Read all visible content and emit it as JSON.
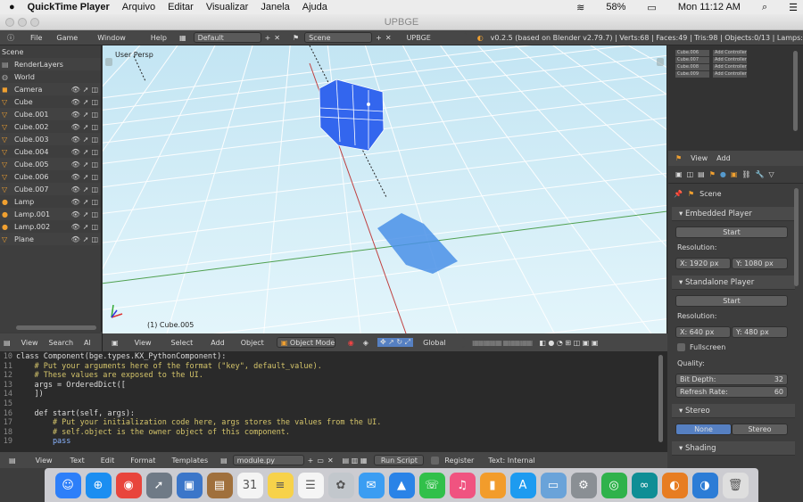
{
  "mac_menu": {
    "apple": "",
    "app": "QuickTime Player",
    "items": [
      "Arquivo",
      "Editar",
      "Visualizar",
      "Janela",
      "Ajuda"
    ],
    "battery": "58%",
    "clock": "Mon 11:12 AM"
  },
  "window": {
    "title": "UPBGE"
  },
  "info_header": {
    "menus": [
      "File",
      "Game",
      "Window",
      "Help"
    ],
    "layout_field": "Default",
    "scene_field": "Scene",
    "engine_field": "UPBGE",
    "stats": "v0.2.5 (based on Blender v2.79.7) | Verts:68 | Faces:49 | Tris:98 | Objects:0/13 | Lamps:"
  },
  "outliner": {
    "root": "Scene",
    "rows": [
      {
        "label": "RenderLayers",
        "icon": "renderlayers-icon"
      },
      {
        "label": "World",
        "icon": "world-icon"
      },
      {
        "label": "Camera",
        "icon": "camera-icon"
      },
      {
        "label": "Cube",
        "icon": "mesh-icon"
      },
      {
        "label": "Cube.001",
        "icon": "mesh-icon"
      },
      {
        "label": "Cube.002",
        "icon": "mesh-icon"
      },
      {
        "label": "Cube.003",
        "icon": "mesh-icon"
      },
      {
        "label": "Cube.004",
        "icon": "mesh-icon"
      },
      {
        "label": "Cube.005",
        "icon": "mesh-icon"
      },
      {
        "label": "Cube.006",
        "icon": "mesh-icon"
      },
      {
        "label": "Cube.007",
        "icon": "mesh-icon"
      },
      {
        "label": "Lamp",
        "icon": "lamp-icon"
      },
      {
        "label": "Lamp.001",
        "icon": "lamp-icon"
      },
      {
        "label": "Lamp.002",
        "icon": "lamp-icon"
      },
      {
        "label": "Plane",
        "icon": "mesh-icon"
      }
    ]
  },
  "viewport": {
    "persp_label": "User Persp",
    "object_label": "(1) Cube.005"
  },
  "viewport_header": {
    "menus": [
      "View",
      "Select",
      "Add",
      "Object"
    ],
    "mode": "Object Mode",
    "pivot": "Global"
  },
  "outliner_footer": {
    "menus": [
      "View",
      "Search",
      "Al"
    ]
  },
  "text_editor": {
    "lines": [
      {
        "n": "10",
        "code": "class Component(bge.types.KX_PythonComponent):",
        "kind": "normal"
      },
      {
        "n": "11",
        "code": "    # Put your arguments here of the format (\"key\", default_value).",
        "kind": "comment"
      },
      {
        "n": "12",
        "code": "    # These values are exposed to the UI.",
        "kind": "comment"
      },
      {
        "n": "13",
        "code": "    args = OrderedDict([",
        "kind": "normal"
      },
      {
        "n": "14",
        "code": "    ])",
        "kind": "normal"
      },
      {
        "n": "15",
        "code": "",
        "kind": "normal"
      },
      {
        "n": "16",
        "code": "    def start(self, args):",
        "kind": "normal"
      },
      {
        "n": "17",
        "code": "        # Put your initialization code here, args stores the values from the UI.",
        "kind": "comment"
      },
      {
        "n": "18",
        "code": "        # self.object is the owner object of this component.",
        "kind": "comment"
      },
      {
        "n": "19",
        "code": "        pass",
        "kind": "keyword"
      }
    ],
    "footer": {
      "menus": [
        "View",
        "Text",
        "Edit",
        "Format",
        "Templates"
      ],
      "file": "module.py",
      "run_script": "Run Script",
      "register": "Register",
      "text_status": "Text: Internal"
    }
  },
  "logic_panel": {
    "controllers": [
      "Cube.006",
      "Cube.007",
      "Cube.008",
      "Cube.009"
    ],
    "controller_type": "Add Controller"
  },
  "properties": {
    "header_menus": [
      "View",
      "Add"
    ],
    "scene": "Scene",
    "embedded": {
      "title": "Embedded Player",
      "start": "Start",
      "resolution_label": "Resolution:",
      "x": "X:  1920 px",
      "y": "Y:  1080 px"
    },
    "standalone": {
      "title": "Standalone Player",
      "start": "Start",
      "resolution_label": "Resolution:",
      "x": "X:   640 px",
      "y": "Y:   480 px",
      "fullscreen": "Fullscreen",
      "quality_label": "Quality:",
      "bit_depth_label": "Bit Depth:",
      "bit_depth": "32",
      "refresh_label": "Refresh Rate:",
      "refresh": "60"
    },
    "stereo": {
      "title": "Stereo",
      "none": "None",
      "stereo": "Stereo"
    },
    "shading": {
      "title": "Shading"
    }
  },
  "dock": {
    "apps": [
      {
        "name": "finder-icon",
        "color": "#2d7ff9",
        "glyph": "☺"
      },
      {
        "name": "safari-icon",
        "color": "#1b8ef1",
        "glyph": "⊕"
      },
      {
        "name": "chrome-icon",
        "color": "#e8453c",
        "glyph": "◉"
      },
      {
        "name": "launchpad-icon",
        "color": "#6f7a86",
        "glyph": "➚"
      },
      {
        "name": "preview-icon",
        "color": "#3b76c9",
        "glyph": "▣"
      },
      {
        "name": "notebook-icon",
        "color": "#a0703c",
        "glyph": "▤"
      },
      {
        "name": "calendar-icon",
        "color": "#f4f4f4",
        "glyph": "31"
      },
      {
        "name": "notes-icon",
        "color": "#f7d24a",
        "glyph": "≡"
      },
      {
        "name": "reminders-icon",
        "color": "#f5f5f5",
        "glyph": "☰"
      },
      {
        "name": "photos-icon",
        "color": "#c2c7cc",
        "glyph": "✿"
      },
      {
        "name": "messages-icon",
        "color": "#3b9df2",
        "glyph": "✉"
      },
      {
        "name": "keynote-icon",
        "color": "#2a83e7",
        "glyph": "▲"
      },
      {
        "name": "facetime-icon",
        "color": "#31c04a",
        "glyph": "☏"
      },
      {
        "name": "itunes-icon",
        "color": "#f05380",
        "glyph": "♫"
      },
      {
        "name": "ibooks-icon",
        "color": "#f29c2b",
        "glyph": "▮"
      },
      {
        "name": "appstore-icon",
        "color": "#1d9bf0",
        "glyph": "A"
      },
      {
        "name": "sysinfo-icon",
        "color": "#6aa3d9",
        "glyph": "▭"
      },
      {
        "name": "settings-icon",
        "color": "#8a8f94",
        "glyph": "⚙"
      },
      {
        "name": "gauge-icon",
        "color": "#2fb24b",
        "glyph": "◎"
      },
      {
        "name": "arduino-icon",
        "color": "#0f8e95",
        "glyph": "∞"
      },
      {
        "name": "blender-icon",
        "color": "#e77d22",
        "glyph": "◐"
      },
      {
        "name": "upbge-icon",
        "color": "#2c7cd6",
        "glyph": "◑"
      },
      {
        "name": "trash-icon",
        "color": "#dedede",
        "glyph": "🗑"
      }
    ]
  }
}
